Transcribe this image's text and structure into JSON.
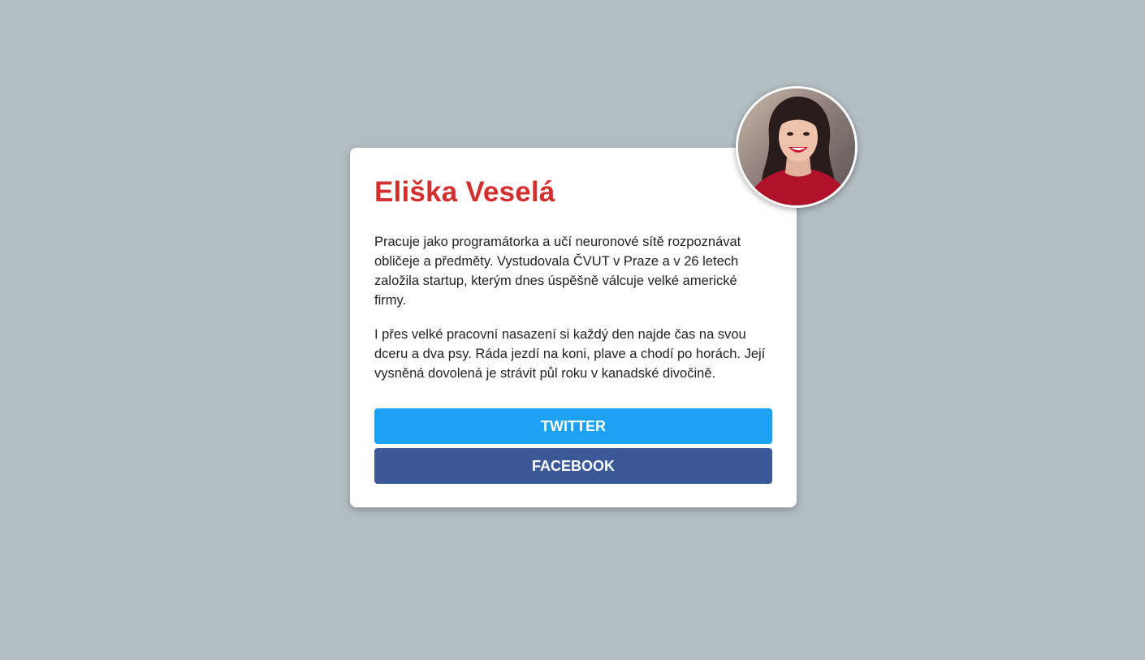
{
  "profile": {
    "name": "Eliška Veselá",
    "bio_paragraph_1": "Pracuje jako programátorka a učí neuronové sítě rozpoznávat obličeje a předměty. Vystudovala ČVUT v Praze a v 26 letech založila startup, kterým dnes úspěšně válcuje velké americké firmy.",
    "bio_paragraph_2": "I přes velké pracovní nasazení si každý den najde čas na svou dceru a dva psy. Ráda jezdí na koni, plave a chodí po horách. Její vysněná dovolená je strávit půl roku v kanadské divočině.",
    "avatar_alt": "Eliška Veselá"
  },
  "buttons": {
    "twitter_label": "TWITTER",
    "facebook_label": "FACEBOOK"
  },
  "colors": {
    "background": "#b3bec3",
    "name": "#d32f2f",
    "twitter": "#1da1f2",
    "facebook": "#3b5998"
  }
}
